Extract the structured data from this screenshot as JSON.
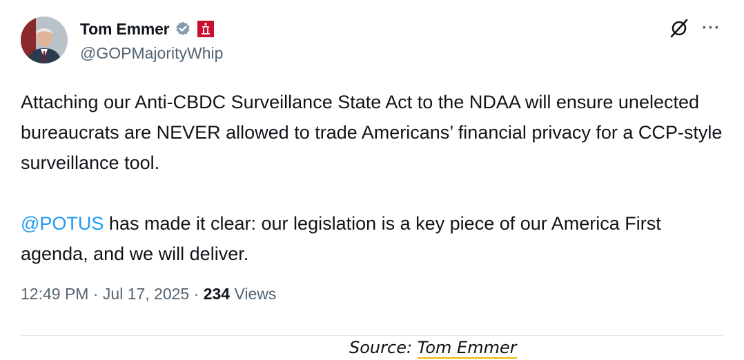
{
  "tweet": {
    "author": {
      "display_name": "Tom Emmer",
      "handle": "@GOPMajorityWhip",
      "verified_icon": "verified-badge-icon",
      "affiliation_icon": "house-of-representatives-badge-icon"
    },
    "actions": {
      "grok_icon": "grok-icon",
      "more_label": "···"
    },
    "paragraph1": "Attaching our Anti-CBDC Surveillance State Act to the NDAA will ensure unelected bureaucrats are NEVER allowed to trade Americans’ financial privacy for a CCP-style surveillance tool.",
    "paragraph2": {
      "mention": "@POTUS",
      "text": " has made it clear: our legislation is a key piece of our America First agenda, and we will deliver."
    },
    "meta": {
      "time": "12:49 PM",
      "separator": " · ",
      "date": "Jul 17, 2025",
      "views_count": "234",
      "views_label": " Views"
    }
  },
  "caption": {
    "prefix": "Source: ",
    "source": "Tom Emmer"
  },
  "colors": {
    "mention": "#1d9bf0",
    "secondary_text": "#536471",
    "primary_text": "#0f1419",
    "verified": "#829aab",
    "gov_badge": "#c8102e",
    "caption_underline": "#f0b400"
  }
}
